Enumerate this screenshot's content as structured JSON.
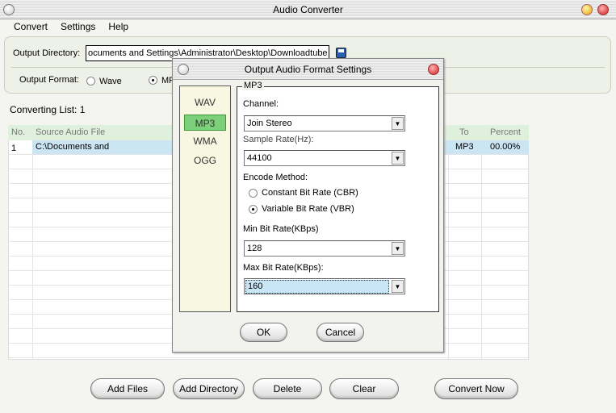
{
  "window": {
    "title": "Audio Converter"
  },
  "menu": [
    "Convert",
    "Settings",
    "Help"
  ],
  "output": {
    "directory_label": "Output Directory:",
    "directory_value": "ocuments and Settings\\Administrator\\Desktop\\Downloadtube",
    "format_label": "Output Format:",
    "format_options": [
      "Wave",
      "MP3"
    ],
    "selected_format": "MP3"
  },
  "list": {
    "label": "Converting List: 1",
    "columns": [
      "No.",
      "Source Audio File",
      "To",
      "Percent"
    ],
    "rows": [
      {
        "no": "1",
        "source": "C:\\Documents and",
        "to": "MP3",
        "percent": "00.00%"
      }
    ]
  },
  "buttons": {
    "add_files": "Add Files",
    "add_directory": "Add Directory",
    "delete": "Delete",
    "clear": "Clear",
    "convert_now": "Convert Now"
  },
  "dialog": {
    "title": "Output Audio Format Settings",
    "formats": [
      "WAV",
      "MP3",
      "WMA",
      "OGG"
    ],
    "selected_format": "MP3",
    "group_label": "MP3",
    "channel_label": "Channel:",
    "channel_value": "Join Stereo",
    "sample_rate_label": "Sample Rate(Hz):",
    "sample_rate_value": "44100",
    "encode_label": "Encode Method:",
    "cbr_label": "Constant Bit Rate (CBR)",
    "vbr_label": "Variable Bit Rate (VBR)",
    "encode_selected": "VBR",
    "min_label": "Min Bit Rate(KBps)",
    "min_value": "128",
    "max_label": "Max Bit Rate(KBps):",
    "max_value": "160",
    "ok": "OK",
    "cancel": "Cancel"
  }
}
